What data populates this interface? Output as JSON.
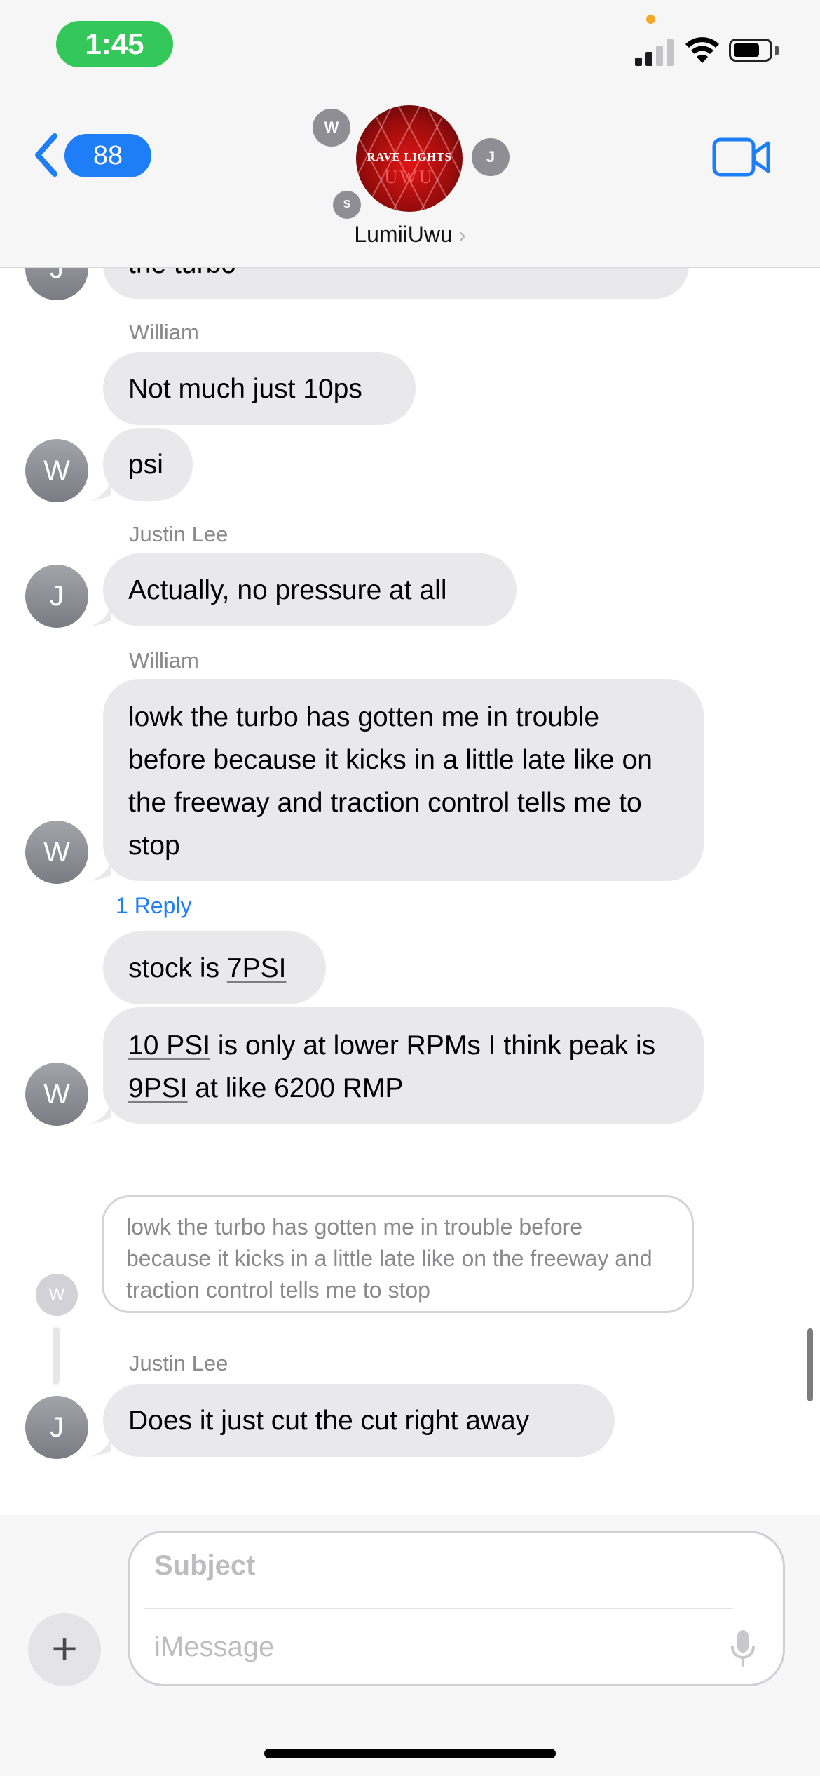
{
  "status_bar": {
    "time": "1:45"
  },
  "header": {
    "back_count": "88",
    "group_name": "LumiiUwu",
    "group_avatar_line1": "RAVE LIGHTS",
    "group_avatar_line2": "UWU",
    "participant_initials": [
      "W",
      "J",
      "S"
    ]
  },
  "messages": {
    "partial_text": "the turbo",
    "partial_avatar": "J",
    "m1_sender": "William",
    "m1_text": "Not much just 10ps",
    "m2_text": "psi",
    "m2_avatar": "W",
    "m3_sender": "Justin Lee",
    "m3_text": "Actually, no pressure at all",
    "m3_avatar": "J",
    "m4_sender": "William",
    "m4_text": "lowk the turbo has gotten me in trouble before because it kicks in a little late like on the freeway and traction control tells me to stop",
    "m4_avatar": "W",
    "m4_reply_link": "1 Reply",
    "m5_pre": "stock is ",
    "m5_link": "7PSI",
    "m6_link1": "10 PSI",
    "m6_mid": " is only at lower RPMs I think peak is ",
    "m6_link2": "9PSI",
    "m6_post": " at like 6200 RMP",
    "m6_avatar": "W"
  },
  "thread_reply": {
    "quoted_text": "lowk the turbo has gotten me in trouble before because it kicks in a little late like on the freeway and traction control tells me to stop",
    "quoted_avatar": "W",
    "sender": "Justin Lee",
    "text": "Does it just cut the cut right away",
    "avatar": "J"
  },
  "compose": {
    "subject_placeholder": "Subject",
    "message_placeholder": "iMessage",
    "plus_label": "+"
  },
  "colors": {
    "accent": "#1e7ef7",
    "bubble": "#e9e9eb",
    "time_pill": "#34c759"
  }
}
